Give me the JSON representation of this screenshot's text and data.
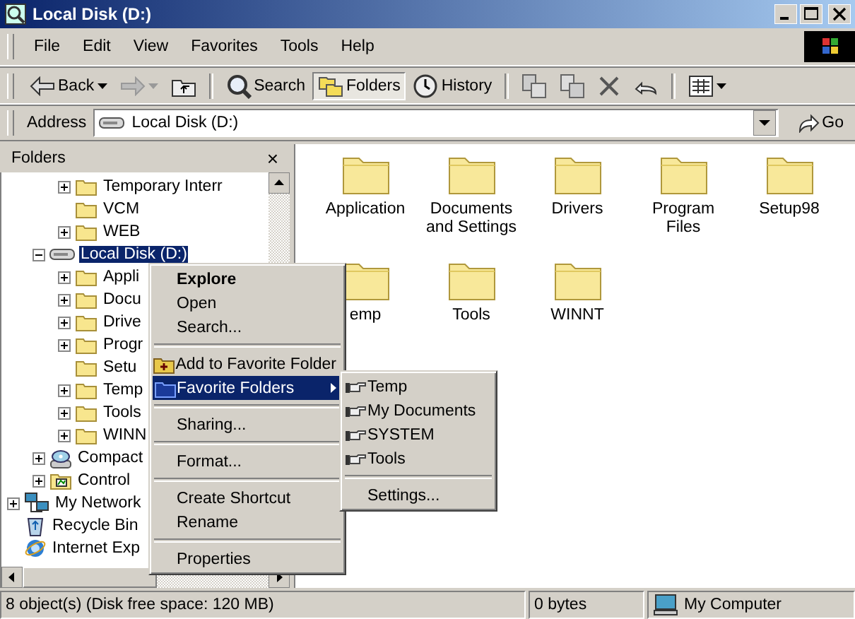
{
  "window": {
    "title": "Local Disk (D:)"
  },
  "menu_bar": [
    "File",
    "Edit",
    "View",
    "Favorites",
    "Tools",
    "Help"
  ],
  "toolbar": [
    {
      "kind": "back",
      "label": "Back"
    },
    {
      "kind": "forward"
    },
    {
      "kind": "up"
    },
    {
      "kind": "separator"
    },
    {
      "kind": "search",
      "label": "Search",
      "pressed": false
    },
    {
      "kind": "folders",
      "label": "Folders",
      "pressed": true
    },
    {
      "kind": "history",
      "label": "History",
      "pressed": false
    },
    {
      "kind": "separator"
    },
    {
      "kind": "move"
    },
    {
      "kind": "copy"
    },
    {
      "kind": "delete"
    },
    {
      "kind": "undo"
    },
    {
      "kind": "separator"
    },
    {
      "kind": "views"
    }
  ],
  "address": {
    "label": "Address",
    "value": "Local Disk (D:)",
    "go": "Go"
  },
  "folders_pane": {
    "title": "Folders",
    "close": "×"
  },
  "tree": [
    {
      "children": [
        {
          "children": [
            {
              "label": "Temporary Interr",
              "kind": "folder",
              "expanded": false,
              "selected": false
            },
            {
              "label": "VCM",
              "kind": "folder",
              "selected": false
            },
            {
              "label": "WEB",
              "kind": "folder",
              "expanded": false,
              "selected": false
            }
          ]
        },
        {
          "label": "Local Disk (D:)",
          "kind": "drive",
          "expanded": true,
          "selected": true,
          "children": [
            {
              "label": "Appli",
              "kind": "folder",
              "expanded": false,
              "selected": false
            },
            {
              "label": "Docu",
              "kind": "folder",
              "expanded": false,
              "selected": false
            },
            {
              "label": "Drive",
              "kind": "folder",
              "expanded": false,
              "selected": false
            },
            {
              "label": "Progr",
              "kind": "folder",
              "expanded": false,
              "selected": false
            },
            {
              "label": "Setu",
              "kind": "folder",
              "selected": false
            },
            {
              "label": "Temp",
              "kind": "folder",
              "expanded": false,
              "selected": false
            },
            {
              "label": "Tools",
              "kind": "folder",
              "expanded": false,
              "selected": false
            },
            {
              "label": "WINN",
              "kind": "folder",
              "expanded": false,
              "selected": false
            }
          ]
        },
        {
          "label": "Compact",
          "kind": "cd",
          "expanded": false,
          "selected": false
        },
        {
          "label": "Control",
          "kind": "control",
          "expanded": false,
          "selected": false
        }
      ]
    },
    {
      "label": "My Network",
      "kind": "network",
      "expanded": false,
      "selected": false
    },
    {
      "label": "Recycle Bin",
      "kind": "recycle",
      "selected": false
    },
    {
      "label": "Internet Exp",
      "kind": "ie",
      "selected": false
    }
  ],
  "files": [
    {
      "label": "Application"
    },
    {
      "label": "Documents and Settings"
    },
    {
      "label": "Drivers"
    },
    {
      "label": "Program Files"
    },
    {
      "label": "Setup98"
    },
    {
      "label": "emp"
    },
    {
      "label": "Tools"
    },
    {
      "label": "WINNT"
    }
  ],
  "context_menu": [
    {
      "kind": "plain",
      "label": "Explore",
      "default": true,
      "selected": false
    },
    {
      "kind": "plain",
      "label": "Open",
      "default": false,
      "selected": false
    },
    {
      "kind": "plain",
      "label": "Search...",
      "default": false,
      "selected": false
    },
    {
      "kind": "separator"
    },
    {
      "kind": "add-folder",
      "label": "Add to Favorite Folder",
      "default": false,
      "selected": false
    },
    {
      "kind": "favorites",
      "label": "Favorite Folders",
      "default": false,
      "selected": true
    },
    {
      "kind": "separator"
    },
    {
      "kind": "plain",
      "label": "Sharing...",
      "default": false,
      "selected": false
    },
    {
      "kind": "separator"
    },
    {
      "kind": "plain",
      "label": "Format...",
      "default": false,
      "selected": false
    },
    {
      "kind": "separator"
    },
    {
      "kind": "plain",
      "label": "Create Shortcut",
      "default": false,
      "selected": false
    },
    {
      "kind": "plain",
      "label": "Rename",
      "default": false,
      "selected": false
    },
    {
      "kind": "separator"
    },
    {
      "kind": "plain",
      "label": "Properties",
      "default": false,
      "selected": false
    }
  ],
  "submenu": [
    {
      "kind": "shortcut",
      "label": "Temp",
      "selected": false
    },
    {
      "kind": "shortcut",
      "label": "My Documents",
      "selected": false
    },
    {
      "kind": "shortcut",
      "label": "SYSTEM",
      "selected": false
    },
    {
      "kind": "shortcut",
      "label": "Tools",
      "selected": false
    },
    {
      "kind": "separator"
    },
    {
      "kind": "plain",
      "label": "Settings...",
      "selected": false
    }
  ],
  "status_bar": {
    "objects": "8 object(s) (Disk free space: 120 MB)",
    "size": "0 bytes",
    "zone": "My Computer"
  }
}
